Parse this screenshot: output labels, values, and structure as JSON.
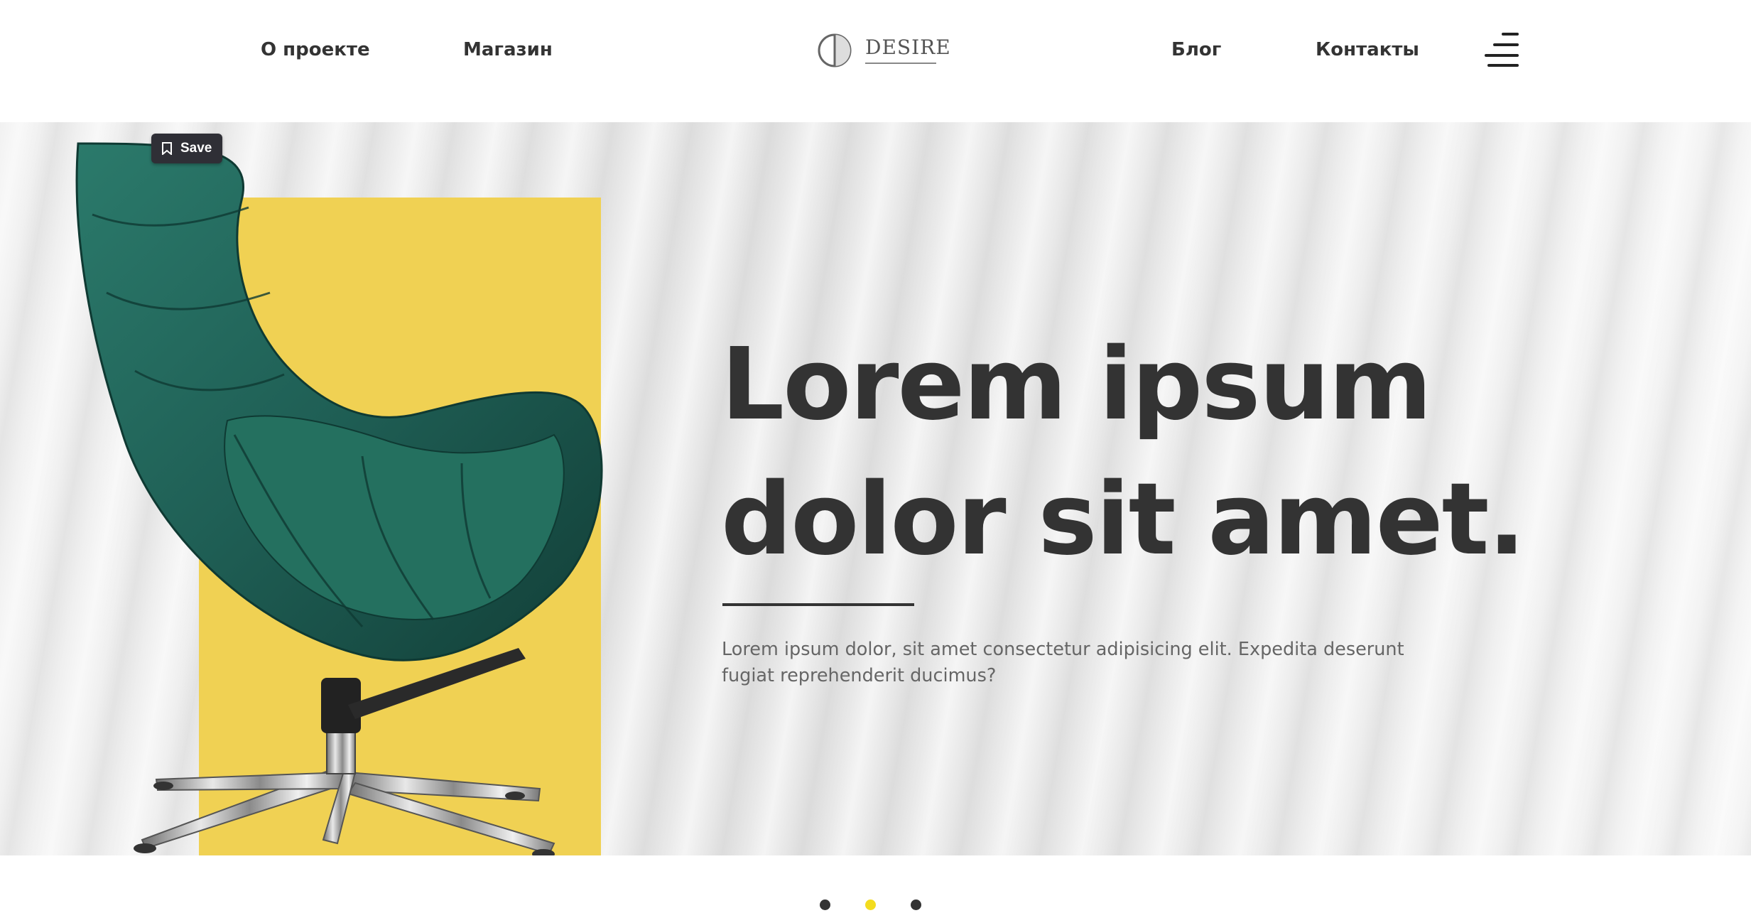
{
  "header": {
    "nav_left": [
      "О проекте",
      "Магазин"
    ],
    "nav_right": [
      "Блог",
      "Контакты"
    ],
    "logo_text": "DESIRE",
    "menu_icon": "hamburger-menu-icon"
  },
  "hero": {
    "save_button_label": "Save",
    "save_icon": "bookmark-icon",
    "headline_line1": "Lorem ipsum",
    "headline_line2": "dolor sit amet.",
    "description_line1": "Lorem ipsum dolor, sit amet consectetur adipisicing elit. Expedita deserunt",
    "description_line2": "fugiat reprehenderit ducimus?",
    "accent_color": "#f0d153",
    "chair_color": "#1f5f55"
  },
  "slider": {
    "slide_count": 3,
    "active_index": 1,
    "active_color": "#f3dc1f",
    "inactive_color": "#333333"
  }
}
